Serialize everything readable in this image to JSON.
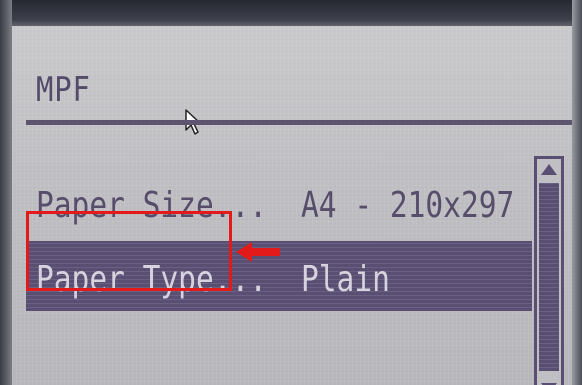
{
  "header": {
    "title": "MPF"
  },
  "menu": {
    "items": [
      {
        "label": "Paper Size...",
        "value": "A4 - 210x297",
        "selected": false
      },
      {
        "label": "Paper Type...",
        "value": "Plain",
        "selected": true
      }
    ]
  },
  "icons": {
    "cursor": "mouse-pointer-icon",
    "scroll_up": "scroll-up-arrow-icon",
    "scroll_down": "scroll-down-arrow-icon",
    "annotation_arrow": "left-arrow-icon"
  },
  "colors": {
    "lcd_background": "#bebec2",
    "lcd_text": "#574d6b",
    "selection": "#5b5173",
    "annotation": "#e21a1a"
  }
}
